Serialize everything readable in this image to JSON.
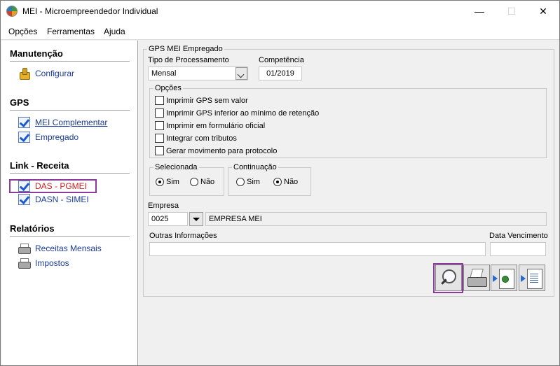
{
  "window": {
    "title": "MEI - Microempreendedor Individual",
    "min_glyph": "—",
    "max_glyph": "☐",
    "close_glyph": "✕"
  },
  "menu": {
    "items": [
      "Opções",
      "Ferramentas",
      "Ajuda"
    ]
  },
  "sidebar": {
    "sections": [
      {
        "title": "Manutenção",
        "items": [
          {
            "label": "Configurar",
            "icon": "gear-icon"
          }
        ]
      },
      {
        "title": "GPS",
        "items": [
          {
            "label": "MEI Complementar",
            "icon": "checkmark-icon"
          },
          {
            "label": "Empregado",
            "icon": "checkmark-icon"
          }
        ]
      },
      {
        "title": "Link - Receita",
        "items": [
          {
            "label": "DAS - PGMEI",
            "icon": "checkmark-icon"
          },
          {
            "label": "DASN - SIMEI",
            "icon": "checkmark-icon"
          }
        ]
      },
      {
        "title": "Relatórios",
        "items": [
          {
            "label": "Receitas Mensais",
            "icon": "printer-icon"
          },
          {
            "label": "Impostos",
            "icon": "printer-icon"
          }
        ]
      }
    ]
  },
  "form": {
    "group_title": "GPS MEI Empregado",
    "tipo_label": "Tipo de Processamento",
    "tipo_value": "Mensal",
    "competencia_label": "Competência",
    "competencia_value": "01/2019",
    "opcoes_title": "Opções",
    "options": [
      {
        "label": "Imprimir GPS sem valor",
        "checked": false
      },
      {
        "label": "Imprimir GPS inferior ao mínimo de retenção",
        "checked": false
      },
      {
        "label": "Imprimir em formulário oficial",
        "checked": false
      },
      {
        "label": "Integrar com tributos",
        "checked": false
      },
      {
        "label": "Gerar movimento para protocolo",
        "checked": false
      }
    ],
    "selecionada": {
      "title": "Selecionada",
      "sim": "Sim",
      "nao": "Não",
      "selected": "Sim"
    },
    "continuacao": {
      "title": "Continuação",
      "sim": "Sim",
      "nao": "Não",
      "selected": "Não"
    },
    "empresa_label": "Empresa",
    "empresa_code": "0025",
    "empresa_name": "EMPRESA MEI",
    "outras_label": "Outras Informações",
    "outras_value": "",
    "vencimento_label": "Data Vencimento",
    "vencimento_value": ""
  },
  "toolbar": {
    "buttons": [
      "preview-icon",
      "print-icon",
      "export-web-icon",
      "export-document-icon"
    ]
  },
  "colors": {
    "highlight": "#8b3b9b",
    "link": "#1a3a9a",
    "link_active": "#d02020"
  }
}
